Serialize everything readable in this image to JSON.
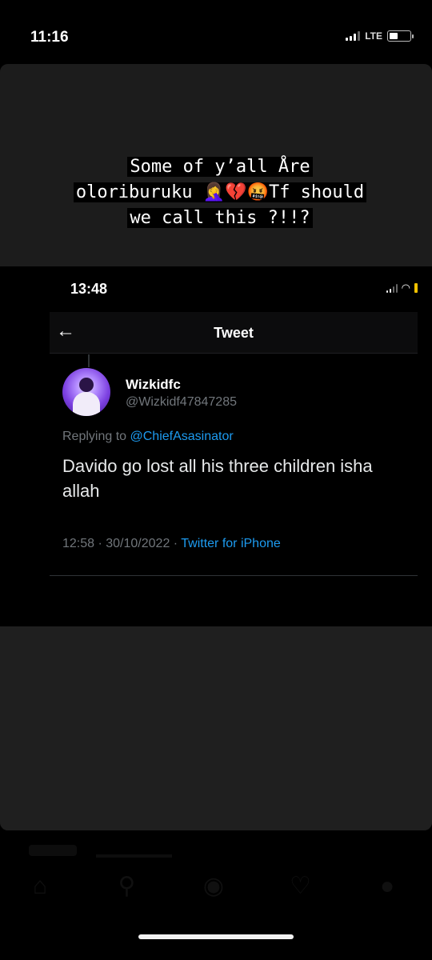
{
  "status_bar": {
    "time": "11:16",
    "network": "LTE"
  },
  "story": {
    "caption_lines": [
      "Some of y’all Åre",
      "oloriburuku 🤦‍♀️💔🤬Tf should",
      "we call this ?!!?"
    ]
  },
  "tweet_screenshot": {
    "status_time": "13:48",
    "header_title": "Tweet",
    "display_name": "Wizkidfc",
    "handle": "@Wizkidf47847285",
    "replying_prefix": "Replying to ",
    "replying_to": "@ChiefAsasinator",
    "text": "Davido go lost all his three children isha allah",
    "timestamp": "12:58 · 30/10/2022 · ",
    "source": "Twitter for iPhone"
  },
  "icons": {
    "back": "back-arrow-icon",
    "nav": [
      "home-icon",
      "search-icon",
      "camera-icon",
      "heart-icon",
      "profile-icon"
    ]
  }
}
